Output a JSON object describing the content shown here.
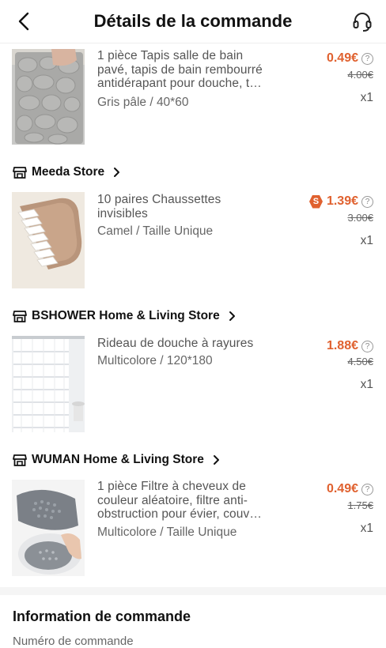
{
  "header": {
    "title": "Détails de la commande",
    "back_icon": "chevron-left-icon",
    "support_icon": "headset-icon"
  },
  "colors": {
    "price_accent": "#e0612f",
    "text_primary": "#111111",
    "text_muted": "#666666"
  },
  "items": [
    {
      "title": "1 pièce Tapis salle de bain pavé, tapis de bain rembourré antidérapant pour douche, t…",
      "variant": "Gris pâle / 40*60",
      "price": "0.49€",
      "old_price": "4.00€",
      "qty": "x1"
    },
    {
      "store": "Meeda Store",
      "title": "10 paires Chaussettes invisibles",
      "variant": "Camel / Taille Unique",
      "price": "1.39€",
      "coin_badge": "S",
      "old_price": "3.00€",
      "qty": "x1"
    },
    {
      "store": "BSHOWER Home & Living Store",
      "title": "Rideau de douche à rayures",
      "variant": "Multicolore / 120*180",
      "price": "1.88€",
      "old_price": "4.50€",
      "qty": "x1"
    },
    {
      "store": "WUMAN Home & Living Store",
      "title": "1 pièce Filtre à cheveux de couleur aléatoire, filtre anti-obstruction pour évier, couv…",
      "variant": "Multicolore / Taille Unique",
      "price": "0.49€",
      "old_price": "1.75€",
      "qty": "x1"
    }
  ],
  "order_info": {
    "title": "Information de commande",
    "subtitle": "Numéro de commande"
  }
}
